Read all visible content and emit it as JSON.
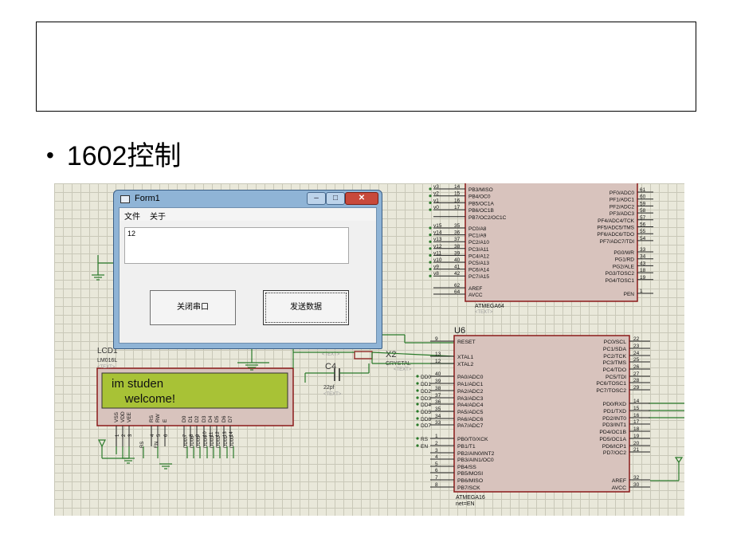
{
  "slide": {
    "heading": "1602控制"
  },
  "form": {
    "title": "Form1",
    "menu": [
      "文件",
      "关于"
    ],
    "textbox_value": "12",
    "button_close_port": "关闭串口",
    "button_send": "发送数据"
  },
  "lcd": {
    "label": "LCD1",
    "model": "LM016L",
    "text_tag": "<TEXT>",
    "line1": "im studen",
    "line2": "    welcome!",
    "pins": [
      "VSS",
      "VDD",
      "VEE",
      "RS",
      "RW",
      "E",
      "D0",
      "D1",
      "D2",
      "D3",
      "D4",
      "D5",
      "D6",
      "D7"
    ],
    "pin_numbers": [
      "1",
      "2",
      "3",
      "4",
      "5",
      "6",
      "7",
      "8",
      "9",
      "10",
      "11",
      "12",
      "13",
      "14"
    ],
    "nets": [
      "RS",
      "EN",
      "DD07",
      "DD06",
      "DD05",
      "DD04",
      "DD03",
      "DD02",
      "DD01",
      "DD00"
    ]
  },
  "crystal": {
    "ref": "X2",
    "type": "CRYSTAL",
    "tag": "<TEXT>"
  },
  "cap": {
    "ref": "C4",
    "value": "22pf",
    "tag": "<TEXT>"
  },
  "mcu_top": {
    "name": "ATMEGA64",
    "tag": "<TEXT>",
    "left_pins": [
      {
        "net": "v3",
        "num": "14",
        "name": "PB3/MISO"
      },
      {
        "net": "v2",
        "num": "15",
        "name": "PB4/OC0"
      },
      {
        "net": "v1",
        "num": "16",
        "name": "PB5/OC1A"
      },
      {
        "net": "v0",
        "num": "17",
        "name": "PB6/OC1B"
      },
      {
        "net": "",
        "num": "",
        "name": "PB7/OC2/OC1C"
      },
      {
        "net": "v15",
        "num": "35",
        "name": "PC0/A8"
      },
      {
        "net": "v14",
        "num": "36",
        "name": "PC1/A9"
      },
      {
        "net": "v13",
        "num": "37",
        "name": "PC2/A10"
      },
      {
        "net": "v12",
        "num": "38",
        "name": "PC3/A11"
      },
      {
        "net": "v11",
        "num": "39",
        "name": "PC4/A12"
      },
      {
        "net": "v10",
        "num": "40",
        "name": "PC5/A13"
      },
      {
        "net": "v9",
        "num": "41",
        "name": "PC6/A14"
      },
      {
        "net": "v8",
        "num": "42",
        "name": "PC7/A15"
      },
      {
        "net": "",
        "num": "62",
        "name": "AREF"
      },
      {
        "net": "",
        "num": "64",
        "name": "AVCC"
      }
    ],
    "right_pins": [
      {
        "name": "PF0/ADC0",
        "num": "61"
      },
      {
        "name": "PF1/ADC1",
        "num": "60"
      },
      {
        "name": "PF2/ADC2",
        "num": "59"
      },
      {
        "name": "PF3/ADC3",
        "num": "58"
      },
      {
        "name": "PF4/ADC4/TCK",
        "num": "57"
      },
      {
        "name": "PF5/ADC5/TMS",
        "num": "56"
      },
      {
        "name": "PF6/ADC6/TDO",
        "num": "55"
      },
      {
        "name": "PF7/ADC7/TDI",
        "num": "54"
      },
      {
        "name": "PG0/WR",
        "num": "33"
      },
      {
        "name": "PG1/RD",
        "num": "34"
      },
      {
        "name": "PG2/ALE",
        "num": "43"
      },
      {
        "name": "PG3/TOSC2",
        "num": "18"
      },
      {
        "name": "PG4/TOSC1",
        "num": "19"
      },
      {
        "name": "PEN",
        "num": "1"
      }
    ]
  },
  "mcu_bottom": {
    "ref": "U6",
    "name": "ATMEGA16",
    "net": "net=EN",
    "left_pins": [
      {
        "net": "",
        "num": "9",
        "name": "RESET"
      },
      {
        "net": "",
        "num": "13",
        "name": "XTAL1"
      },
      {
        "net": "",
        "num": "12",
        "name": "XTAL2"
      },
      {
        "net": "DD0",
        "num": "40",
        "name": "PA0/ADC0"
      },
      {
        "net": "DD1",
        "num": "39",
        "name": "PA1/ADC1"
      },
      {
        "net": "DD2",
        "num": "38",
        "name": "PA2/ADC2"
      },
      {
        "net": "DD3",
        "num": "37",
        "name": "PA3/ADC3"
      },
      {
        "net": "DD4",
        "num": "36",
        "name": "PA4/ADC4"
      },
      {
        "net": "DD5",
        "num": "35",
        "name": "PA5/ADC5"
      },
      {
        "net": "DD6",
        "num": "34",
        "name": "PA6/ADC6"
      },
      {
        "net": "DD7",
        "num": "33",
        "name": "PA7/ADC7"
      },
      {
        "net": "RS",
        "num": "1",
        "name": "PB0/T0/XCK"
      },
      {
        "net": "EN",
        "num": "2",
        "name": "PB1/T1"
      },
      {
        "net": "",
        "num": "3",
        "name": "PB2/AIN0/INT2"
      },
      {
        "net": "",
        "num": "4",
        "name": "PB3/AIN1/OC0"
      },
      {
        "net": "",
        "num": "5",
        "name": "PB4/SS"
      },
      {
        "net": "",
        "num": "6",
        "name": "PB5/MOSI"
      },
      {
        "net": "",
        "num": "7",
        "name": "PB6/MISO"
      },
      {
        "net": "",
        "num": "8",
        "name": "PB7/SCK"
      }
    ],
    "right_pins": [
      {
        "name": "PC0/SCL",
        "num": "22"
      },
      {
        "name": "PC1/SDA",
        "num": "23"
      },
      {
        "name": "PC2/TCK",
        "num": "24"
      },
      {
        "name": "PC3/TMS",
        "num": "25"
      },
      {
        "name": "PC4/TDO",
        "num": "26"
      },
      {
        "name": "PC5/TDI",
        "num": "27"
      },
      {
        "name": "PC6/TOSC1",
        "num": "28"
      },
      {
        "name": "PC7/TOSC2",
        "num": "29"
      },
      {
        "name": "PD0/RXD",
        "num": "14"
      },
      {
        "name": "PD1/TXD",
        "num": "15"
      },
      {
        "name": "PD2/INT0",
        "num": "16"
      },
      {
        "name": "PD3/INT1",
        "num": "17"
      },
      {
        "name": "PD4/OC1B",
        "num": "18"
      },
      {
        "name": "PD5/OC1A",
        "num": "19"
      },
      {
        "name": "PD6/ICP1",
        "num": "20"
      },
      {
        "name": "PD7/OC2",
        "num": "21"
      },
      {
        "name": "AREF",
        "num": "32"
      },
      {
        "name": "AVCC",
        "num": "30"
      }
    ]
  },
  "colors": {
    "wire": "#2a7a2a",
    "body": "#d8c3bd",
    "outline": "#8b1a1a",
    "lcd_screen": "#a8c236",
    "grid_bg": "#e9e8da"
  }
}
